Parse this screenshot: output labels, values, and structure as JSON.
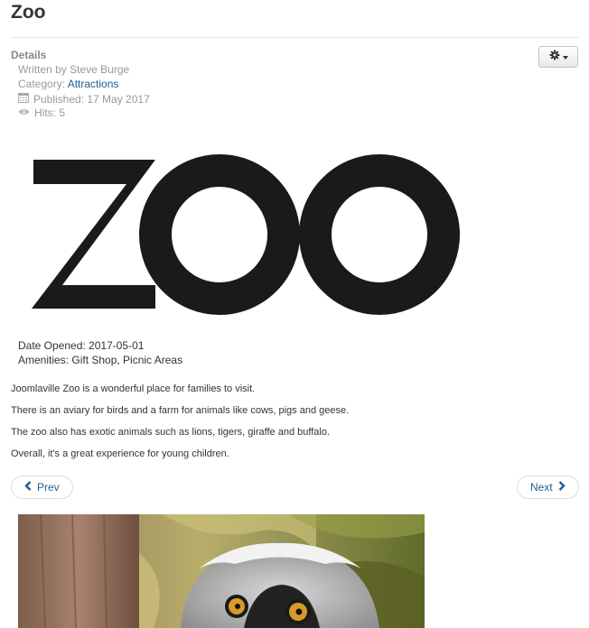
{
  "article": {
    "title": "Zoo"
  },
  "details": {
    "heading": "Details",
    "written_by": "Written by Steve Burge",
    "category_label": "Category:",
    "category_link": "Attractions",
    "published": "Published: 17 May 2017",
    "hits": "Hits: 5"
  },
  "logo": {
    "text": "ZOO"
  },
  "fields": {
    "date_opened": "Date Opened: 2017-05-01",
    "amenities": "Amenities: Gift Shop, Picnic Areas"
  },
  "body": {
    "paragraphs": [
      "Joomlaville Zoo is a wonderful place for families to visit.",
      "There is an aviary for birds and a farm for animals like cows, pigs and geese.",
      "The zoo also has exotic animals such as lions, tigers, giraffe and buffalo.",
      "Overall, it's a great experience for young children."
    ]
  },
  "pager": {
    "prev": "Prev",
    "next": "Next"
  },
  "colors": {
    "link": "#1f5c94",
    "meta_text": "#999999",
    "logo": "#1a1a1a"
  },
  "icons": {
    "tools": "gear-icon",
    "published": "calendar-icon",
    "hits": "eye-icon",
    "prev": "chevron-left-icon",
    "next": "chevron-right-icon"
  }
}
